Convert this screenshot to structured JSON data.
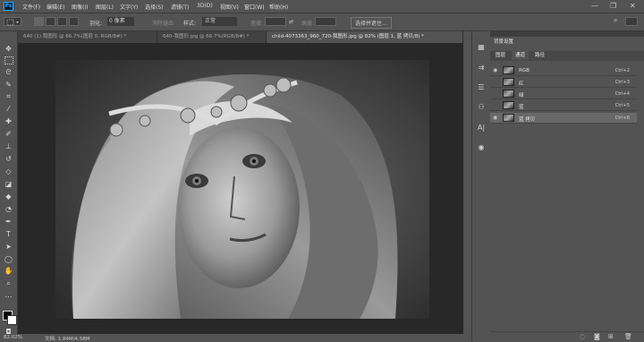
{
  "menubar": {
    "logo": "Ps",
    "items": [
      "文件(F)",
      "编辑(E)",
      "图像(I)",
      "图层(L)",
      "文字(Y)",
      "选择(S)",
      "滤镜(T)",
      "3D(D)",
      "视图(V)",
      "窗口(W)",
      "帮助(H)"
    ],
    "window_controls": [
      "—",
      "❐",
      "✕"
    ]
  },
  "options": {
    "feather_label": "羽化:",
    "feather_value": "0 像素",
    "antialias": "消除锯齿",
    "style_label": "样式:",
    "style_value": "正常",
    "width_label": "宽度:",
    "height_label": "高度:",
    "select_mask_button": "选择并遮住..."
  },
  "tabs": [
    {
      "label": "640 (1).我图形 @ 66.7%(图层 0, RGB/8#) *",
      "active": false
    },
    {
      "label": "640-我图形.jpg @ 66.7%(RGB/8#) *",
      "active": false
    },
    {
      "label": "child-4073363_960_720-我图形.jpg @ 82% (图层 1, 蓝 拷贝/8) *",
      "active": true
    }
  ],
  "status": {
    "zoom": "82.02%",
    "doc": "文档: 1.84M/4.58M"
  },
  "panel": {
    "title": "背景设置",
    "tabs": [
      "图层",
      "通道",
      "路径"
    ],
    "active_tab": "通道",
    "channels": [
      {
        "name": "RGB",
        "shortcut": "Ctrl+2",
        "selected": false
      },
      {
        "name": "红",
        "shortcut": "Ctrl+3",
        "selected": false
      },
      {
        "name": "绿",
        "shortcut": "Ctrl+4",
        "selected": false
      },
      {
        "name": "蓝",
        "shortcut": "Ctrl+5",
        "selected": false
      },
      {
        "name": "蓝 拷贝",
        "shortcut": "Ctrl+6",
        "selected": true
      }
    ]
  },
  "toolbar_icons": [
    "move-icon",
    "marquee-icon",
    "lasso-icon",
    "quick-select-icon",
    "crop-icon",
    "eyedropper-icon",
    "healing-icon",
    "brush-icon",
    "stamp-icon",
    "history-brush-icon",
    "eraser-icon",
    "gradient-icon",
    "blur-icon",
    "dodge-icon",
    "pen-icon",
    "type-icon",
    "path-select-icon",
    "shape-icon",
    "hand-icon",
    "zoom-icon",
    "more-icon"
  ]
}
